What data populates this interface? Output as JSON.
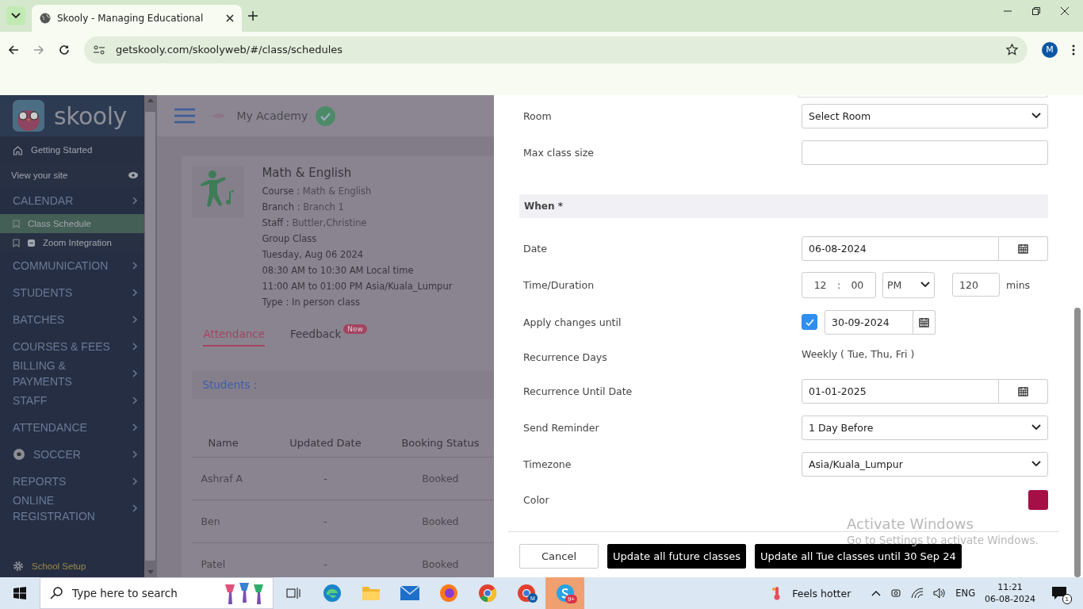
{
  "browser": {
    "tab_title": "Skooly - Managing Educational",
    "url": "getskooly.com/skoolyweb/#/class/schedules",
    "profile": "M"
  },
  "sidebar": {
    "logo": "skooly",
    "items": [
      {
        "kind": "link",
        "label": "Getting Started",
        "selected": false
      },
      {
        "kind": "site",
        "label": "View your site",
        "selected": false
      },
      {
        "kind": "section",
        "label": "CALENDAR",
        "selected": false
      },
      {
        "kind": "sub",
        "label": "Class Schedule",
        "selected": true
      },
      {
        "kind": "sub",
        "label": "Zoom Integration",
        "selected": false
      },
      {
        "kind": "section",
        "label": "COMMUNICATION",
        "selected": false
      },
      {
        "kind": "section",
        "label": "STUDENTS",
        "selected": false
      },
      {
        "kind": "section",
        "label": "BATCHES",
        "selected": false
      },
      {
        "kind": "section",
        "label": "COURSES & FEES",
        "selected": false
      },
      {
        "kind": "section",
        "label": "BILLING & PAYMENTS",
        "selected": false
      },
      {
        "kind": "section",
        "label": "STAFF",
        "selected": false
      },
      {
        "kind": "section",
        "label": "ATTENDANCE",
        "selected": false
      },
      {
        "kind": "sport",
        "label": "SOCCER",
        "selected": false
      },
      {
        "kind": "section",
        "label": "REPORTS",
        "selected": false
      },
      {
        "kind": "section",
        "label": "ONLINE REGISTRATION",
        "selected": false
      },
      {
        "kind": "setup",
        "label": "School Setup",
        "selected": false
      }
    ]
  },
  "header": {
    "academy": "My Academy"
  },
  "class_card": {
    "title": "Math & English",
    "details": [
      {
        "label": "Course :",
        "value": "Math & English"
      },
      {
        "label": "Branch :",
        "value": "Branch 1"
      },
      {
        "label": "Staff :",
        "value": "Buttler,Christine"
      },
      {
        "label": "Group Class"
      },
      {
        "label": "Tuesday, Aug 06 2024"
      },
      {
        "label": "08:30 AM to 10:30 AM Local time"
      },
      {
        "label": "11:00 AM to 01:00 PM Asia/Kuala_Lumpur"
      },
      {
        "label": "Type : In person class"
      }
    ]
  },
  "tabs": [
    {
      "label": "Attendance",
      "selected": true
    },
    {
      "label": "Feedback",
      "badge": "New",
      "selected": false
    }
  ],
  "students_heading": "Students :",
  "table": {
    "columns": [
      "Name",
      "Updated Date",
      "Booking Status"
    ],
    "rows": [
      [
        "Ashraf A",
        "-",
        "Booked"
      ],
      [
        "Ben",
        "-",
        "Booked"
      ],
      [
        "Patel",
        "-",
        "Booked"
      ]
    ]
  },
  "form": {
    "rows": [
      {
        "kind": "select",
        "label": "Room",
        "value": "Select Room"
      },
      {
        "kind": "input",
        "label": "Max class size"
      },
      {
        "kind": "section",
        "label": "When *"
      },
      {
        "kind": "date",
        "label": "Date",
        "value": "06-08-2024"
      },
      {
        "kind": "time",
        "label": "Time/Duration",
        "hour": "12",
        "separator": ":",
        "minute": "00",
        "period": "PM",
        "duration": "120",
        "unit": "mins"
      },
      {
        "kind": "checkdate",
        "label": "Apply changes until",
        "checked": true,
        "value": "30-09-2024"
      },
      {
        "kind": "text",
        "label": "Recurrence Days",
        "value": "Weekly ( Tue, Thu, Fri )"
      },
      {
        "kind": "date",
        "label": "Recurrence Until Date",
        "value": "01-01-2025"
      },
      {
        "kind": "select",
        "label": "Send Reminder",
        "value": "1 Day Before"
      },
      {
        "kind": "select",
        "label": "Timezone",
        "value": "Asia/Kuala_Lumpur"
      },
      {
        "kind": "color",
        "label": "Color",
        "color": "#a50f45"
      }
    ],
    "buttons": [
      {
        "kind": "outline",
        "label": "Cancel"
      },
      {
        "kind": "dark",
        "label": "Update all future classes"
      },
      {
        "kind": "dark",
        "label": "Update all Tue classes until 30 Sep 24"
      }
    ]
  },
  "activation": {
    "title": "Activate Windows",
    "subtitle": "Go to Settings to activate Windows."
  },
  "taskbar": {
    "search_placeholder": "Type here to search",
    "chrome_profile": "M",
    "skype_badge": "9+",
    "weather": "Feels hotter",
    "language": "ENG",
    "time": "11:21",
    "date": "06-08-2024",
    "notifications": "1"
  }
}
